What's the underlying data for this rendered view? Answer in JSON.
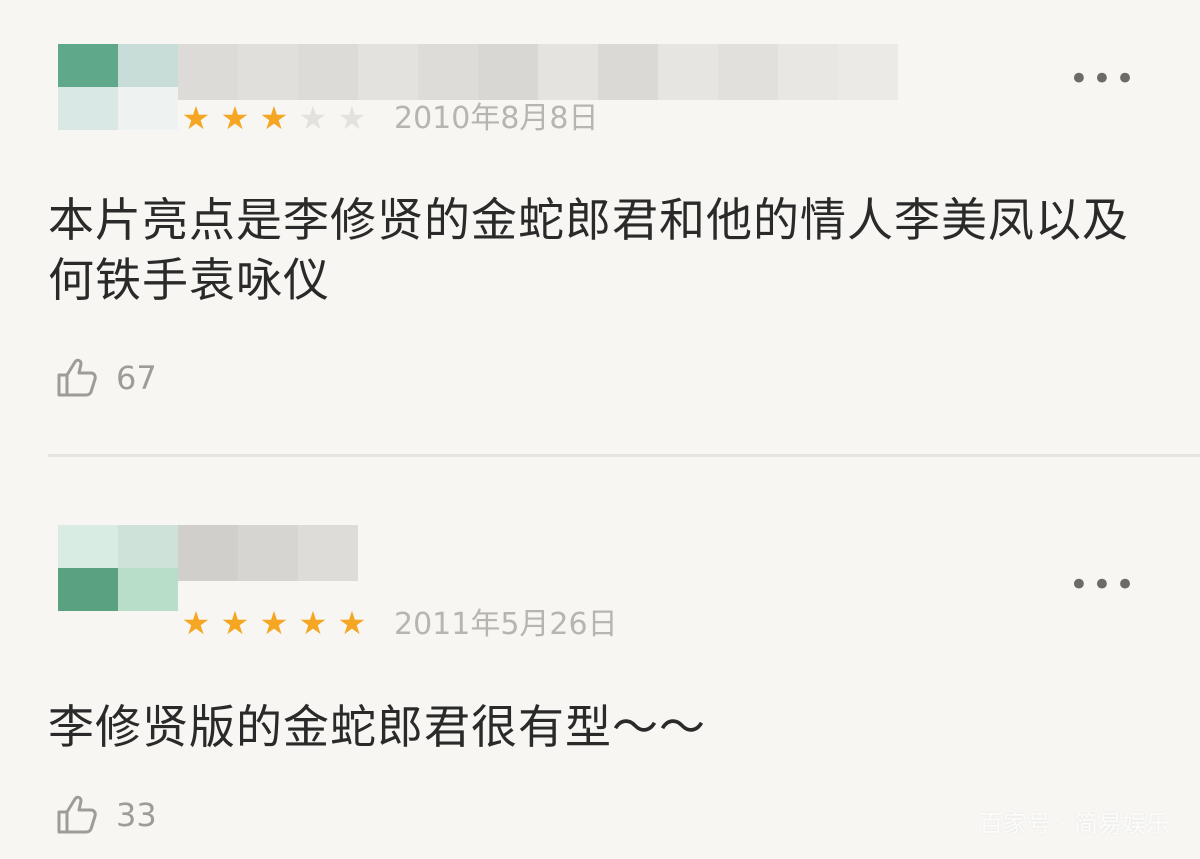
{
  "reviews": [
    {
      "stars_filled": 3,
      "stars_total": 5,
      "date": "2010年8月8日",
      "text": "本片亮点是李修贤的金蛇郎君和他的情人李美凤以及何铁手袁咏仪",
      "likes": "67"
    },
    {
      "stars_filled": 5,
      "stars_total": 5,
      "date": "2011年5月26日",
      "text": "李修贤版的金蛇郎君很有型～～",
      "likes": "33"
    }
  ],
  "ui": {
    "more_label": "•••",
    "star_glyph": "★",
    "like_icon": "thumbs-up-icon"
  },
  "colors": {
    "background": "#f7f6f2",
    "star_filled": "#f5a623",
    "star_empty": "#e4e2de",
    "text": "#2a2a2a",
    "muted": "#b7b5b0"
  },
  "watermark": "百家号 · 简易娱乐"
}
